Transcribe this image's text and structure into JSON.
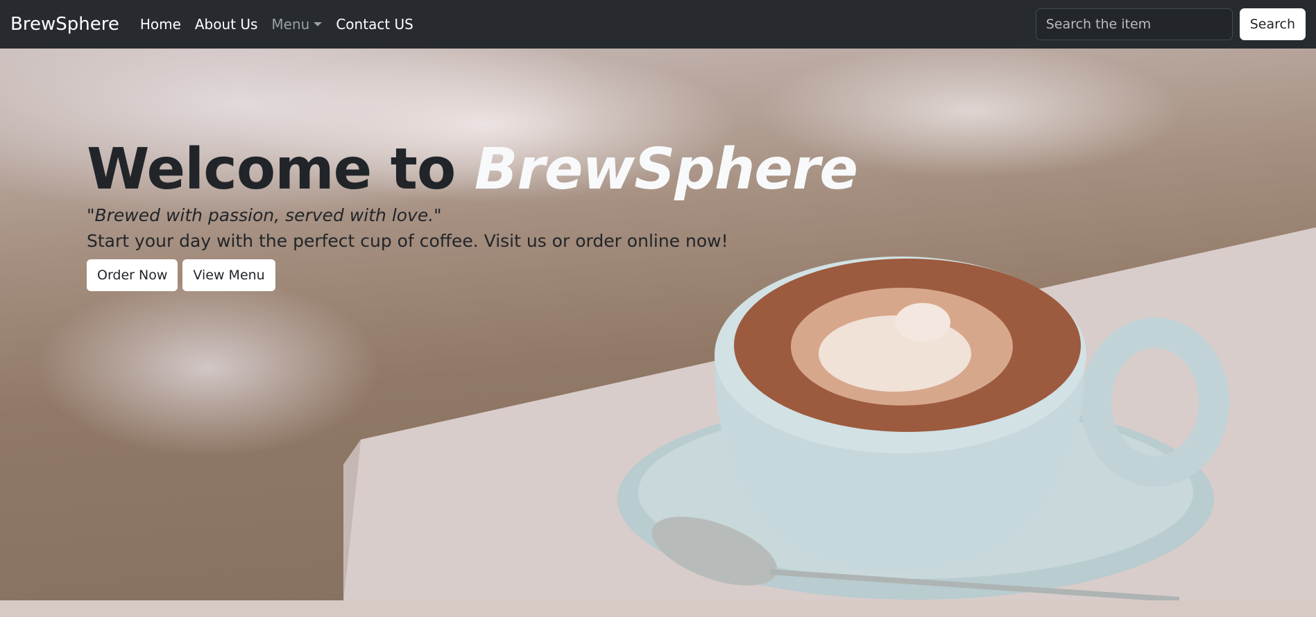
{
  "navbar": {
    "brand": "BrewSphere",
    "links": [
      {
        "label": "Home"
      },
      {
        "label": "About Us"
      },
      {
        "label": "Menu"
      },
      {
        "label": "Contact US"
      }
    ],
    "search": {
      "placeholder": "Search the item",
      "value": "",
      "button_label": "Search"
    }
  },
  "hero": {
    "title_prefix": "Welcome to ",
    "title_brand": "BrewSphere",
    "tagline": "\"Brewed with passion, served with love.\"",
    "lead": "Start your day with the perfect cup of coffee. Visit us or order online now!",
    "buttons": {
      "order_label": "Order Now",
      "menu_label": "View Menu"
    }
  },
  "colors": {
    "navbar_bg": "#272b30",
    "footer_bg": "#d7cac4",
    "title_dark": "#212529",
    "title_brand": "#f8f9fa"
  }
}
